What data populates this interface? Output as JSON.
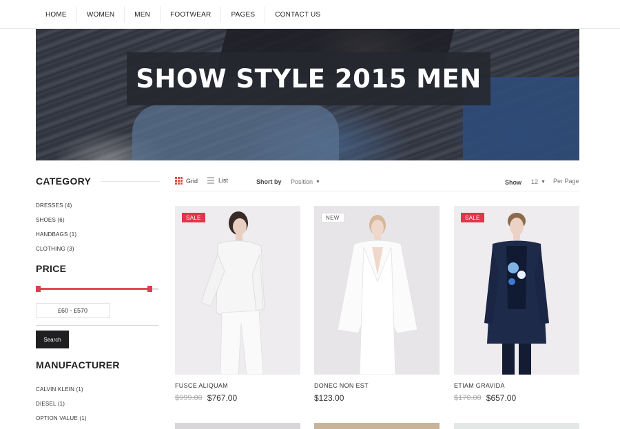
{
  "nav": {
    "items": [
      "HOME",
      "WOMEN",
      "MEN",
      "FOOTWEAR",
      "PAGES",
      "CONTACT US"
    ]
  },
  "hero": {
    "title": "SHOW STYLE 2015 MEN"
  },
  "sidebar": {
    "category_title": "CATEGORY",
    "categories": [
      "DRESSES (4)",
      "SHOES (6)",
      "HANDBAGS (1)",
      "CLOTHING (3)"
    ],
    "price_title": "PRICE",
    "price_range": "£60 - £570",
    "search_label": "Search",
    "manufacturer_title": "MANUFACTURER",
    "manufacturers": [
      "CALVIN KLEIN (1)",
      "DIESEL (1)",
      "OPTION VALUE (1)"
    ]
  },
  "toolbar": {
    "grid_label": "Grid",
    "list_label": "List",
    "sort_label": "Short by",
    "sort_value": "Position",
    "show_label": "Show",
    "show_value": "12",
    "per_page_label": "Per Page"
  },
  "products": [
    {
      "badge": "SALE",
      "name": "FUSCE ALIQUAM",
      "old_price": "$999.00",
      "price": "$767.00"
    },
    {
      "badge": "NEW",
      "name": "DONEC NON EST",
      "old_price": "",
      "price": "$123.00"
    },
    {
      "badge": "SALE",
      "name": "ETIAM GRAVIDA",
      "old_price": "$170.00",
      "price": "$657.00"
    }
  ],
  "colors": {
    "accent": "#e0354b",
    "button_dark": "#1f1f22",
    "hero_banner": "#262830"
  }
}
